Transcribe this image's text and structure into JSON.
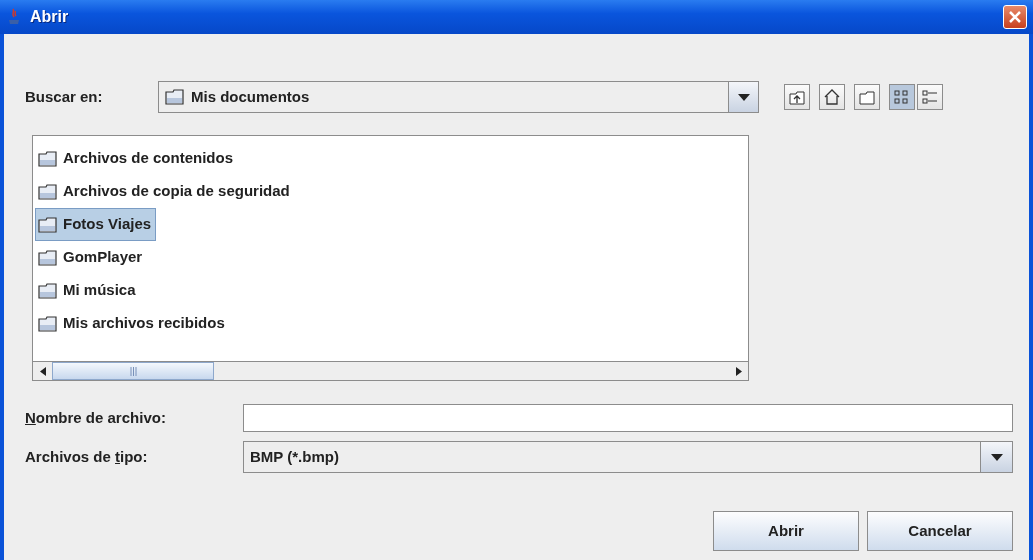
{
  "window": {
    "title": "Abrir"
  },
  "look_in": {
    "label": "Buscar en:",
    "value": "Mis documentos"
  },
  "toolbar": [
    {
      "kind": "up",
      "selected": false
    },
    {
      "kind": "home",
      "selected": false
    },
    {
      "kind": "newfolder",
      "selected": false
    },
    {
      "kind": "list",
      "selected": true
    },
    {
      "kind": "details",
      "selected": false
    }
  ],
  "files": [
    {
      "name": "Archivos de contenidos",
      "selected": false
    },
    {
      "name": "Archivos de copia de seguridad",
      "selected": false
    },
    {
      "name": "Fotos Viajes",
      "selected": true
    },
    {
      "name": "GomPlayer",
      "selected": false
    },
    {
      "name": "Mi música",
      "selected": false
    },
    {
      "name": "Mis archivos recibidos",
      "selected": false
    }
  ],
  "file_name": {
    "label_parts": [
      {
        "text": "N",
        "underlined": true
      },
      {
        "text": "ombre de archivo:",
        "underlined": false
      }
    ]
  },
  "file_type": {
    "label_parts": [
      {
        "text": "Archivos de ",
        "underlined": false
      },
      {
        "text": "t",
        "underlined": true
      },
      {
        "text": "ipo:",
        "underlined": false
      }
    ],
    "value": "BMP (*.bmp)"
  },
  "buttons": [
    "Abrir",
    "Cancelar"
  ]
}
